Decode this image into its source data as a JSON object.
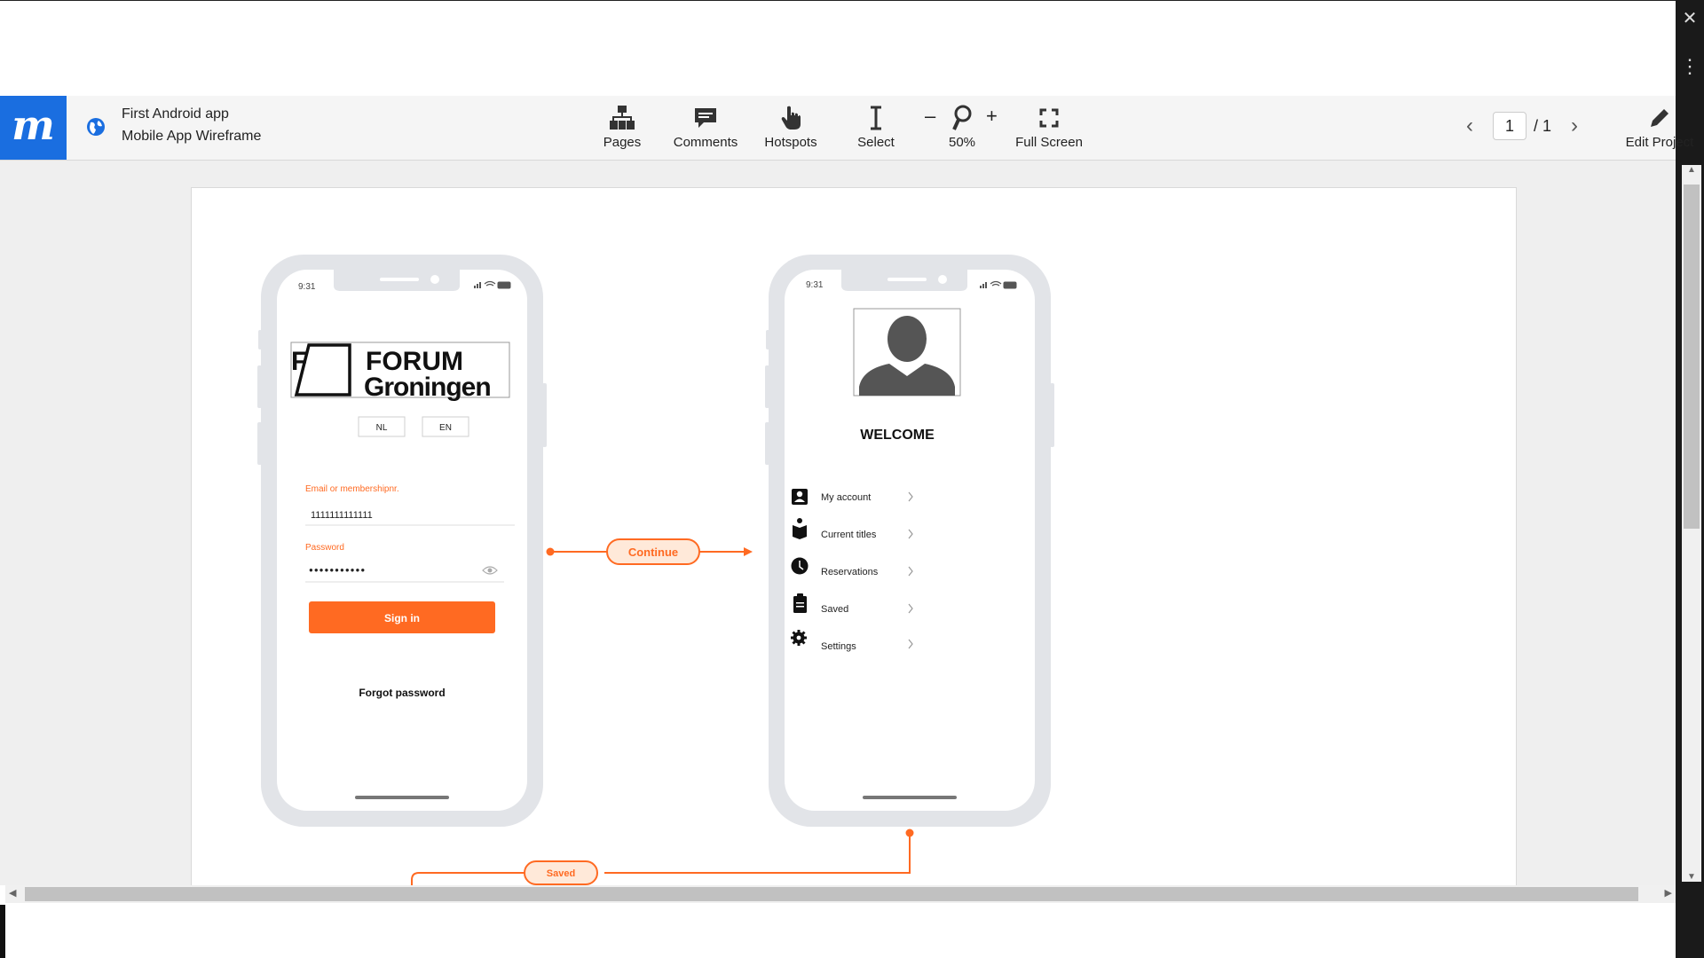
{
  "app": {
    "logo_letter": "m"
  },
  "project": {
    "name": "First Android app",
    "type": "Mobile App Wireframe"
  },
  "toolbar": {
    "pages": "Pages",
    "comments": "Comments",
    "hotspots": "Hotspots",
    "select": "Select",
    "zoom_minus": "–",
    "zoom_plus": "+",
    "zoom_level": "50%",
    "fullscreen": "Full Screen",
    "edit": "Edit Project"
  },
  "pager": {
    "current": "1",
    "total": "/ 1"
  },
  "window": {
    "close": "✕",
    "menu": "⋮"
  },
  "screen1": {
    "time": "9:31",
    "logo_mark": "F",
    "logo_line1": "FORUM",
    "logo_line2": "Groningen",
    "lang_nl": "NL",
    "lang_en": "EN",
    "email_label": "Email or membershipnr.",
    "email_value": "1111111111111",
    "password_label": "Password",
    "password_value": "●●●●●●●●●●●",
    "sign_in": "Sign in",
    "forgot": "Forgot password"
  },
  "screen2": {
    "time": "9:31",
    "welcome": "WELCOME",
    "menu": [
      {
        "label": "My account",
        "icon": "account-icon"
      },
      {
        "label": "Current titles",
        "icon": "book-icon"
      },
      {
        "label": "Reservations",
        "icon": "clock-icon"
      },
      {
        "label": "Saved",
        "icon": "clipboard-icon"
      },
      {
        "label": "Settings",
        "icon": "gear-icon"
      }
    ]
  },
  "links": {
    "continue": "Continue",
    "saved": "Saved"
  },
  "colors": {
    "accent": "#ff6a22",
    "brand": "#1a6ee0"
  }
}
